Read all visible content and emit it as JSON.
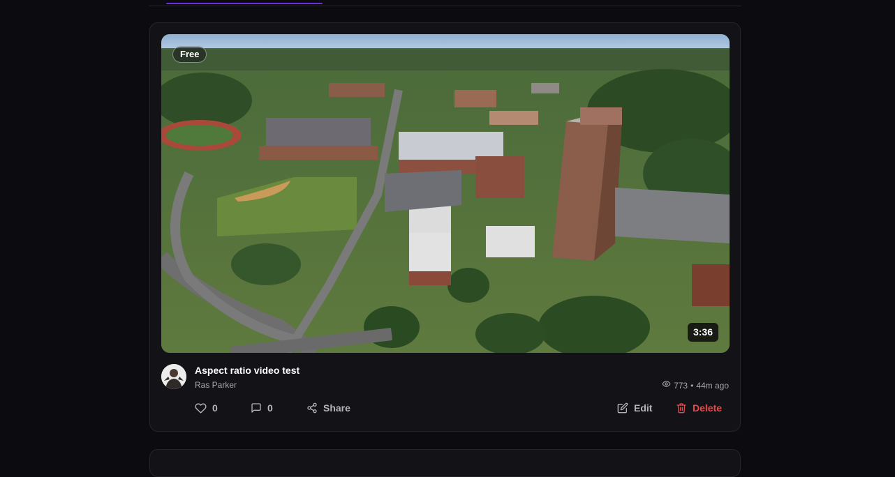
{
  "feed": {
    "active_tab_color": "#6d2ee0"
  },
  "post": {
    "badge": "Free",
    "duration": "3:36",
    "title": "Aspect ratio video test",
    "author": "Ras Parker",
    "views": "773",
    "separator": "•",
    "posted": "44m ago",
    "likes": "0",
    "comments": "0",
    "share_label": "Share",
    "edit_label": "Edit",
    "delete_label": "Delete",
    "delete_color": "#f04848",
    "icons": {
      "views": "eye-icon",
      "like": "heart-icon",
      "comment": "comment-icon",
      "share": "share-icon",
      "edit": "edit-icon",
      "delete": "trash-icon"
    }
  }
}
